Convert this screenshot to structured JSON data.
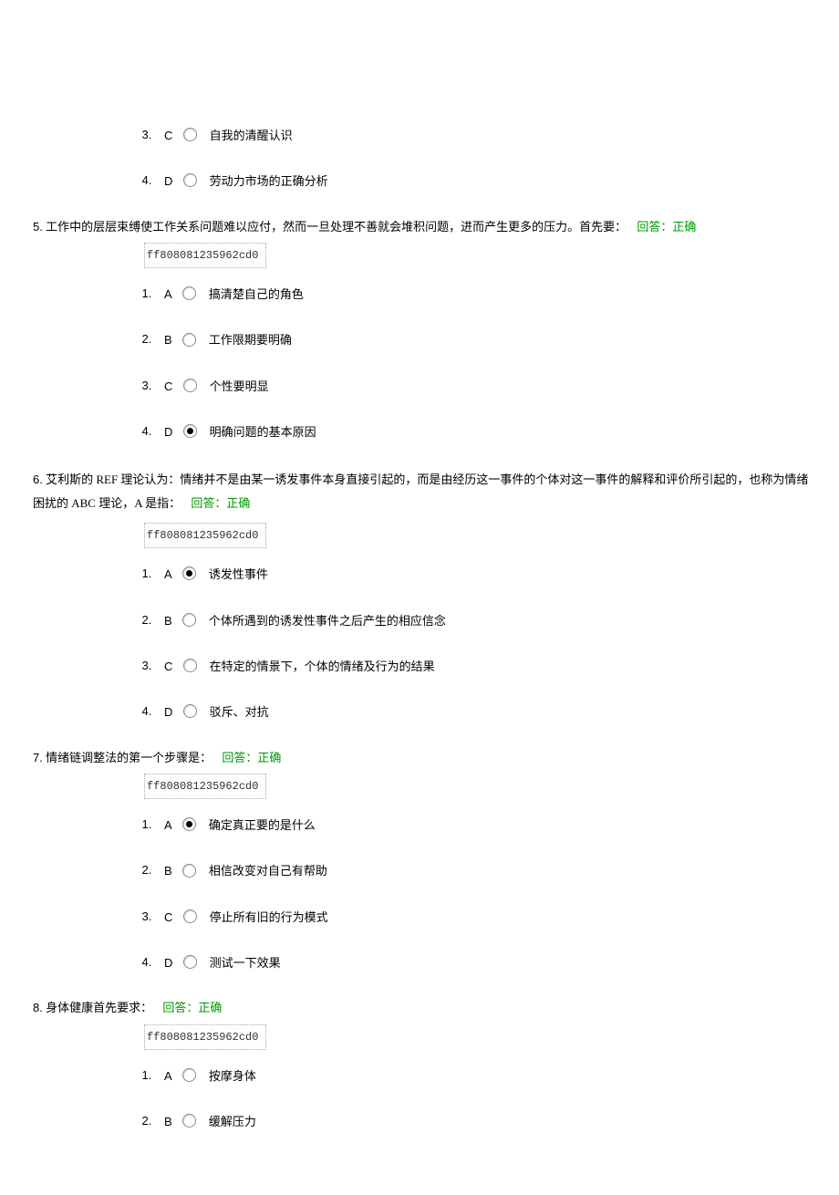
{
  "fragment": {
    "options": [
      {
        "letter": "C",
        "text": "自我的清醒认识",
        "selected": false
      },
      {
        "letter": "D",
        "text": "劳动力市场的正确分析",
        "selected": false
      }
    ]
  },
  "questions": [
    {
      "num": "5.",
      "text": "工作中的层层束缚使工作关系问题难以应付，然而一旦处理不善就会堆积问题，进而产生更多的压力。首先要：",
      "answer_label": "回答：正确",
      "code": "ff808081235962cd0",
      "options": [
        {
          "letter": "A",
          "text": "搞清楚自己的角色",
          "selected": false
        },
        {
          "letter": "B",
          "text": "工作限期要明确",
          "selected": false
        },
        {
          "letter": "C",
          "text": "个性要明显",
          "selected": false
        },
        {
          "letter": "D",
          "text": "明确问题的基本原因",
          "selected": true
        }
      ]
    },
    {
      "num": "6.",
      "text": "艾利斯的 REF 理论认为：情绪并不是由某一诱发事件本身直接引起的，而是由经历这一事件的个体对这一事件的解释和评价所引起的，也称为情绪困扰的 ABC 理论，A 是指：",
      "answer_label": "回答：正确",
      "code": "ff808081235962cd0",
      "options": [
        {
          "letter": "A",
          "text": "诱发性事件",
          "selected": true
        },
        {
          "letter": "B",
          "text": "个体所遇到的诱发性事件之后产生的相应信念",
          "selected": false
        },
        {
          "letter": "C",
          "text": "在特定的情景下，个体的情绪及行为的结果",
          "selected": false
        },
        {
          "letter": "D",
          "text": "驳斥、对抗",
          "selected": false
        }
      ]
    },
    {
      "num": "7.",
      "text": "情绪链调整法的第一个步骤是：",
      "answer_label": "回答：正确",
      "code": "ff808081235962cd0",
      "options": [
        {
          "letter": "A",
          "text": "确定真正要的是什么",
          "selected": true
        },
        {
          "letter": "B",
          "text": "相信改变对自己有帮助",
          "selected": false
        },
        {
          "letter": "C",
          "text": "停止所有旧的行为模式",
          "selected": false
        },
        {
          "letter": "D",
          "text": "测试一下效果",
          "selected": false
        }
      ]
    },
    {
      "num": "8.",
      "text": "身体健康首先要求：",
      "answer_label": "回答：正确",
      "code": "ff808081235962cd0",
      "options": [
        {
          "letter": "A",
          "text": "按摩身体",
          "selected": false
        },
        {
          "letter": "B",
          "text": "缓解压力",
          "selected": false
        }
      ]
    }
  ]
}
